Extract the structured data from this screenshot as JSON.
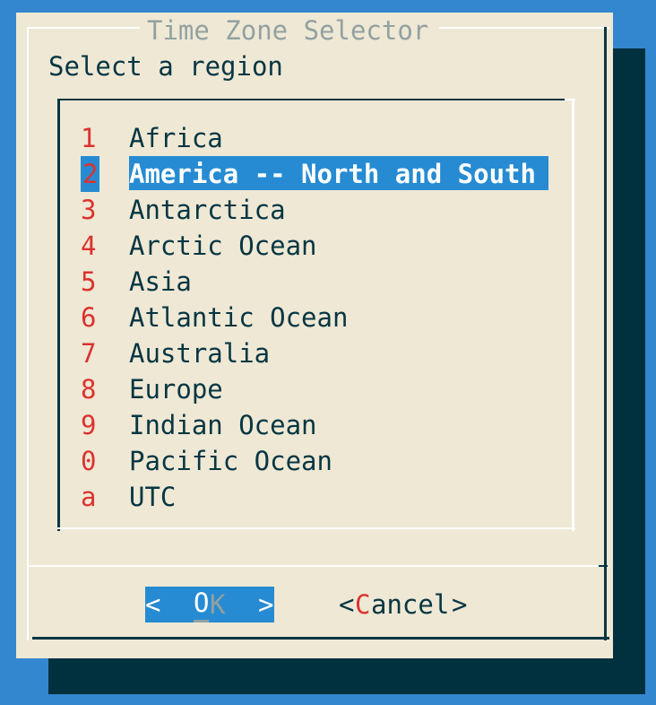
{
  "dialog": {
    "title": "Time Zone Selector",
    "prompt": "Select a region",
    "items": [
      {
        "key": "1",
        "label": "Africa"
      },
      {
        "key": "2",
        "label": "America -- North and South"
      },
      {
        "key": "3",
        "label": "Antarctica"
      },
      {
        "key": "4",
        "label": "Arctic Ocean"
      },
      {
        "key": "5",
        "label": "Asia"
      },
      {
        "key": "6",
        "label": "Atlantic Ocean"
      },
      {
        "key": "7",
        "label": "Australia"
      },
      {
        "key": "8",
        "label": "Europe"
      },
      {
        "key": "9",
        "label": "Indian Ocean"
      },
      {
        "key": "0",
        "label": "Pacific Ocean"
      },
      {
        "key": "a",
        "label": "UTC"
      }
    ],
    "buttons": {
      "ok": {
        "left": "<",
        "hot": "O",
        "rest": "K",
        "right": ">"
      },
      "cancel": {
        "left": "<",
        "hot": "C",
        "rest": "ancel",
        "right": ">"
      }
    },
    "colors": {
      "background": "#3387cf",
      "dialog": "#eee8d5",
      "shadow": "#01313f",
      "text": "#073642",
      "hotkey": "#dc322f",
      "selection": "#268bd2",
      "title": "#93a1a1"
    }
  }
}
